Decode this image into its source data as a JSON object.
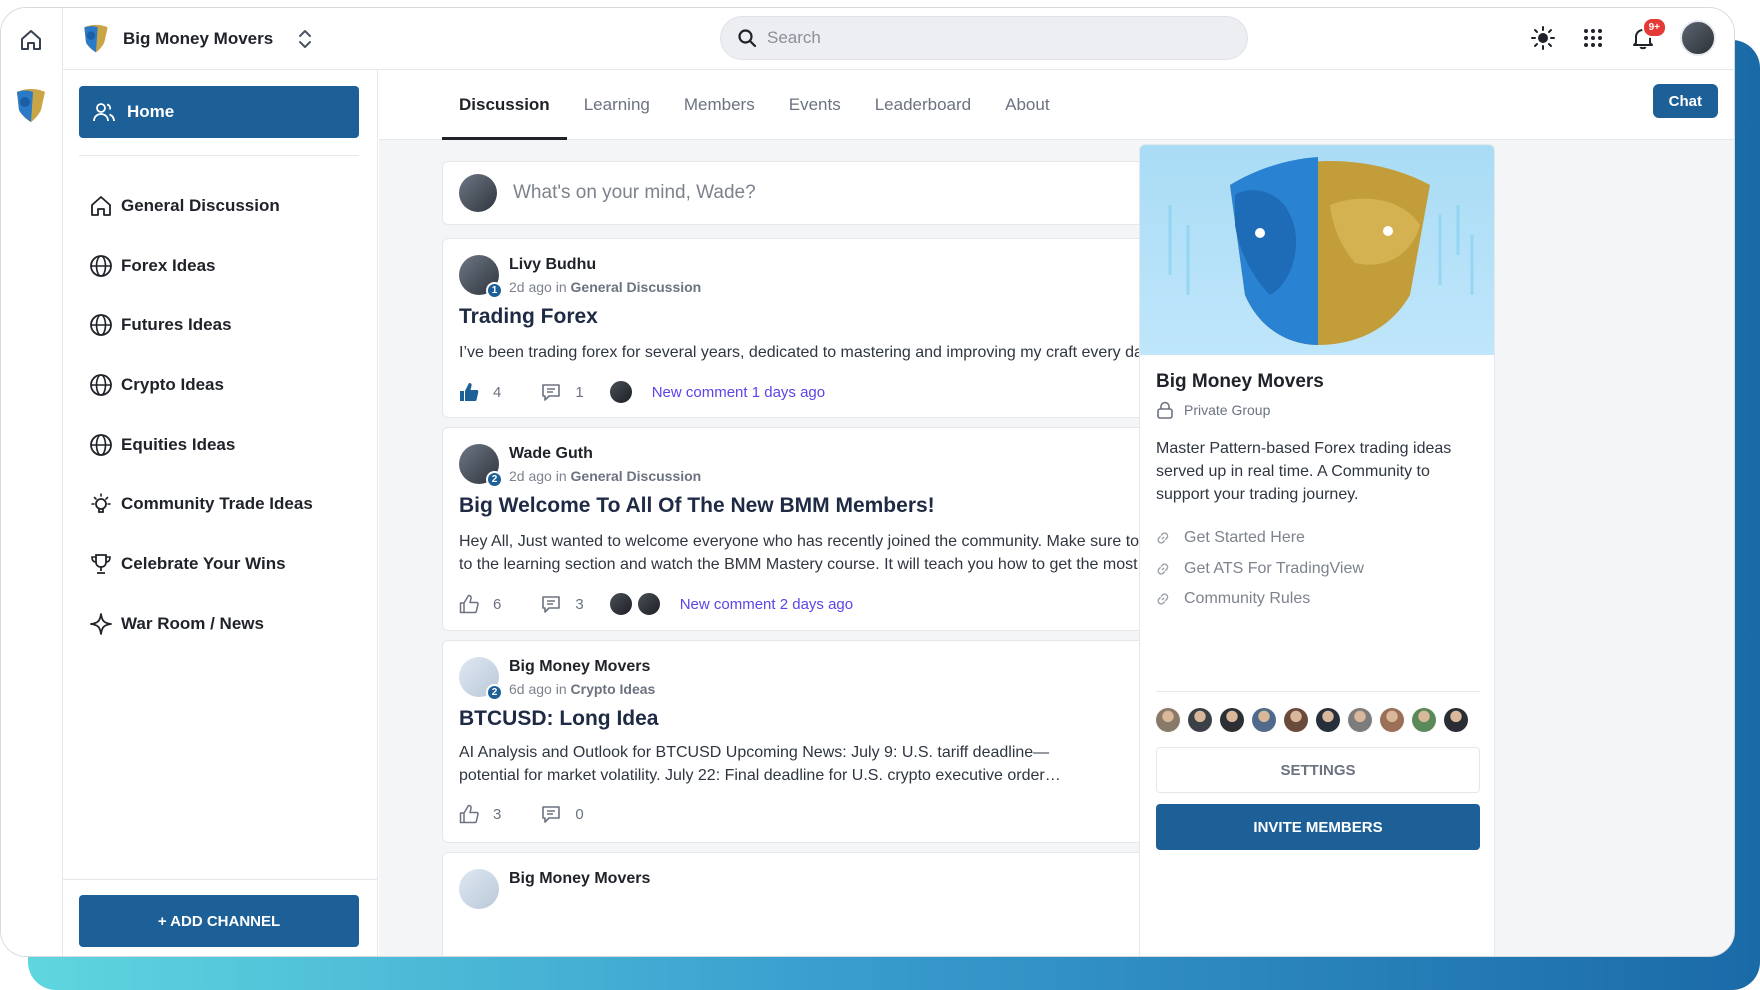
{
  "topbar": {
    "brand_name": "Big Money Movers",
    "search_placeholder": "Search",
    "notif_badge": "9+"
  },
  "sidebar": {
    "home_label": "Home",
    "channels": [
      {
        "label": "General Discussion",
        "icon": "home-icon"
      },
      {
        "label": "Forex Ideas",
        "icon": "globe-icon"
      },
      {
        "label": "Futures Ideas",
        "icon": "globe-icon"
      },
      {
        "label": "Crypto Ideas",
        "icon": "globe-icon"
      },
      {
        "label": "Equities Ideas",
        "icon": "globe-icon"
      },
      {
        "label": "Community Trade Ideas",
        "icon": "lightbulb-icon"
      },
      {
        "label": "Celebrate Your Wins",
        "icon": "trophy-icon"
      },
      {
        "label": "War Room / News",
        "icon": "sparkle-icon"
      }
    ],
    "add_channel_label": "+ ADD CHANNEL"
  },
  "tabs": [
    "Discussion",
    "Learning",
    "Members",
    "Events",
    "Leaderboard",
    "About"
  ],
  "chat_label": "Chat",
  "composer_placeholder": "What's on your mind, Wade?",
  "posts": [
    {
      "author": "Livy Budhu",
      "level": "1",
      "time": "2d ago",
      "in_word": "in",
      "channel": "General Discussion",
      "title": "Trading Forex",
      "body": "I’ve been trading forex for several years, dedicated to mastering and improving my craft every day.",
      "likes": "4",
      "comments": "1",
      "new_comment": "New comment 1 days ago"
    },
    {
      "author": "Wade Guth",
      "level": "2",
      "time": "2d ago",
      "in_word": "in",
      "channel": "General Discussion",
      "title": "Big Welcome To All Of The New BMM Members!",
      "body_line1": "Hey All, Just wanted to welcome everyone who has recently joined the community. Make sure to go",
      "body_line2": "to the learning section and watch the BMM Mastery course. It will teach you how to get the most ou…",
      "likes": "6",
      "comments": "3",
      "new_comment": "New comment 2 days ago"
    },
    {
      "author": "Big Money Movers",
      "level": "2",
      "time": "6d ago",
      "in_word": "in",
      "channel": "Crypto Ideas",
      "title": "BTCUSD: Long Idea",
      "body_line1": "AI Analysis and Outlook for BTCUSD Upcoming News: July 9: U.S. tariff deadline—",
      "body_line2": "potential for market volatility. July 22: Final deadline for U.S. crypto executive order…",
      "likes": "3",
      "comments": "0"
    },
    {
      "author": "Big Money Movers"
    }
  ],
  "group": {
    "name": "Big Money Movers",
    "type": "Private Group",
    "description": "Master Pattern-based Forex trading ideas served up in real time. A Community to support your trading journey.",
    "links": [
      "Get Started Here",
      "Get ATS For TradingView",
      "Community Rules"
    ],
    "settings_label": "SETTINGS",
    "invite_label": "INVITE MEMBERS",
    "member_colors": [
      "#8a7a6a",
      "#3b3f46",
      "#2c2f33",
      "#4f6a8a",
      "#6a4a3a",
      "#25303c",
      "#7d7d7d",
      "#9a7058",
      "#5a8a5a",
      "#2a2d33"
    ]
  },
  "colors": {
    "primary": "#1d5f97",
    "link": "#5a45e8",
    "badge": "#e53935"
  }
}
